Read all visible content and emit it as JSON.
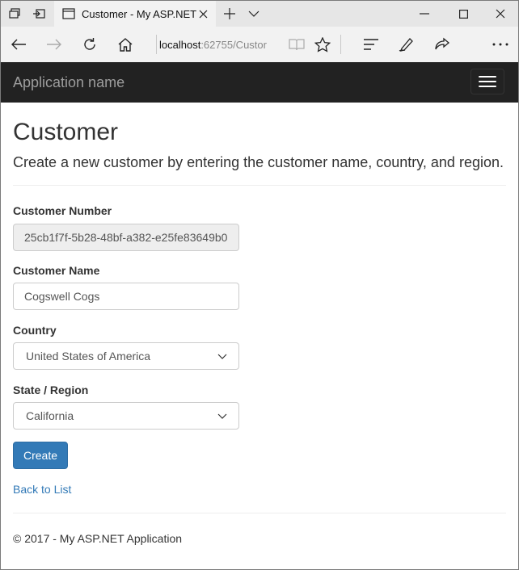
{
  "browser": {
    "tab_title": "Customer - My ASP.NET",
    "url_host": "localhost",
    "url_rest": ":62755/Custor",
    "icons": [
      "tabs-preview-icon",
      "set-aside-tabs-icon",
      "page-icon",
      "close-tab-icon",
      "new-tab-icon",
      "tab-list-chevron-icon",
      "minimize-icon",
      "maximize-icon",
      "close-window-icon",
      "back-icon",
      "forward-icon",
      "refresh-icon",
      "home-icon",
      "reading-view-icon",
      "favorite-star-icon",
      "hub-icon",
      "web-note-icon",
      "share-icon",
      "more-icon"
    ]
  },
  "app": {
    "brand": "Application name"
  },
  "page": {
    "title": "Customer",
    "lead": "Create a new customer by entering the customer name, country, and region."
  },
  "form": {
    "customer_number_label": "Customer Number",
    "customer_number_value": "25cb1f7f-5b28-48bf-a382-e25fe83649b0",
    "customer_name_label": "Customer Name",
    "customer_name_value": "Cogswell Cogs",
    "country_label": "Country",
    "country_value": "United States of America",
    "region_label": "State / Region",
    "region_value": "California",
    "create_label": "Create"
  },
  "links": {
    "back": "Back to List"
  },
  "footer": {
    "text": "© 2017 - My ASP.NET Application"
  },
  "colors": {
    "navbar_bg": "#222222",
    "primary": "#337ab7",
    "chrome_bg": "#f2f2f2",
    "tabstrip_bg": "#e6e6e6"
  }
}
